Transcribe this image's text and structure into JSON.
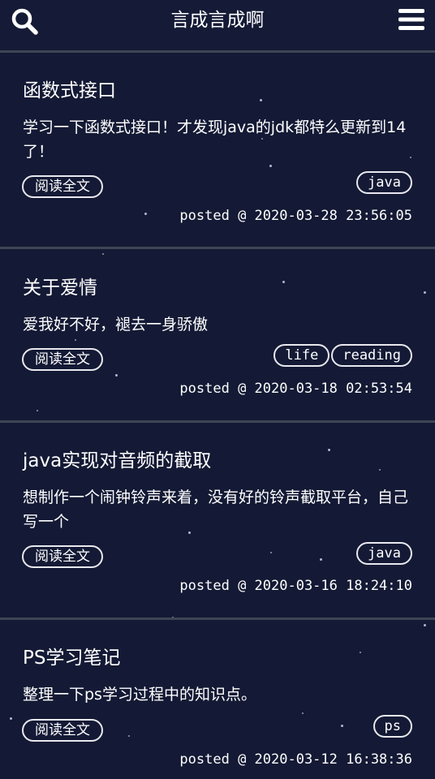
{
  "header": {
    "title": "言成言成啊",
    "search_icon": "search-icon",
    "menu_icon": "hamburger-menu-icon"
  },
  "read_more_label": "阅读全文",
  "posts": [
    {
      "title": "函数式接口",
      "summary": "学习一下函数式接口！才发现java的jdk都特么更新到14了！",
      "tags": [
        "java"
      ],
      "posted": "posted @ 2020-03-28 23:56:05"
    },
    {
      "title": "关于爱情",
      "summary": "爱我好不好，褪去一身骄傲",
      "tags": [
        "life",
        "reading"
      ],
      "posted": "posted @ 2020-03-18 02:53:54"
    },
    {
      "title": "java实现对音频的截取",
      "summary": "想制作一个闹钟铃声来着，没有好的铃声截取平台，自己写一个",
      "tags": [
        "java"
      ],
      "posted": "posted @ 2020-03-16 18:24:10"
    },
    {
      "title": "PS学习笔记",
      "summary": "整理一下ps学习过程中的知识点。",
      "tags": [
        "ps"
      ],
      "posted": "posted @ 2020-03-12 16:38:36"
    }
  ]
}
